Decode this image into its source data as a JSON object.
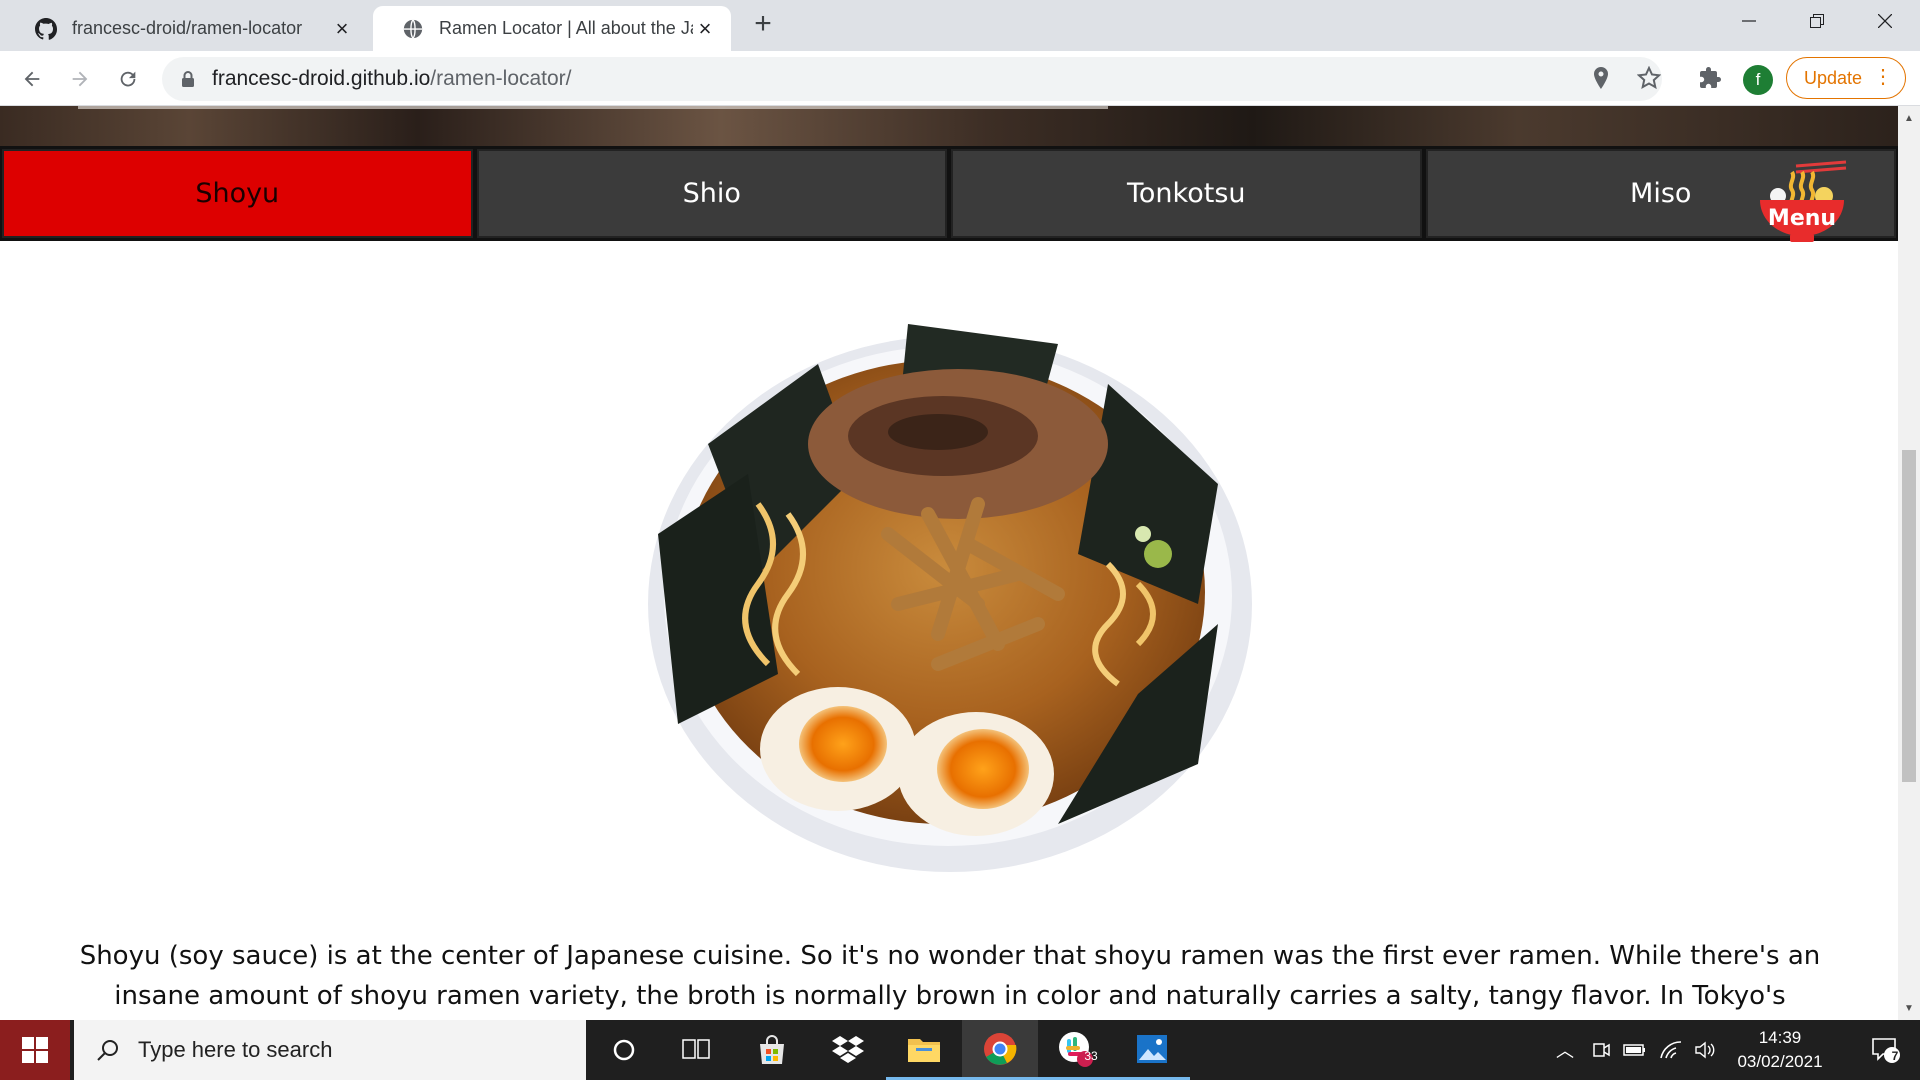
{
  "browser": {
    "tabs": [
      {
        "title": "francesc-droid/ramen-locator",
        "icon": "github-icon",
        "active": false
      },
      {
        "title": "Ramen Locator | All about the Ja",
        "icon": "globe-icon",
        "active": true
      }
    ],
    "new_tab_label": "+",
    "address": {
      "domain": "francesc-droid.github.io",
      "path": "/ramen-locator/"
    },
    "profile_initial": "f",
    "update_label": "Update"
  },
  "page": {
    "ramen_types": [
      {
        "label": "Shoyu",
        "active": true
      },
      {
        "label": "Shio",
        "active": false
      },
      {
        "label": "Tonkotsu",
        "active": false
      },
      {
        "label": "Miso",
        "active": false
      }
    ],
    "menu_label": "Menu",
    "description": "Shoyu (soy sauce) is at the center of Japanese cuisine. So it's no wonder that shoyu ramen was the first ever ramen. While there's an insane amount of shoyu ramen variety, the broth is normally brown in color and naturally carries a salty, tangy flavor. In Tokyo's version,"
  },
  "taskbar": {
    "search_placeholder": "Type here to search",
    "slack_badge": "33",
    "time": "14:39",
    "date": "03/02/2021",
    "notifications": "7"
  },
  "colors": {
    "active_tab": "#dd0000",
    "inactive_tab": "#3b3b3b",
    "update_accent": "#e37400",
    "taskbar_bg": "#1f1f1f"
  }
}
